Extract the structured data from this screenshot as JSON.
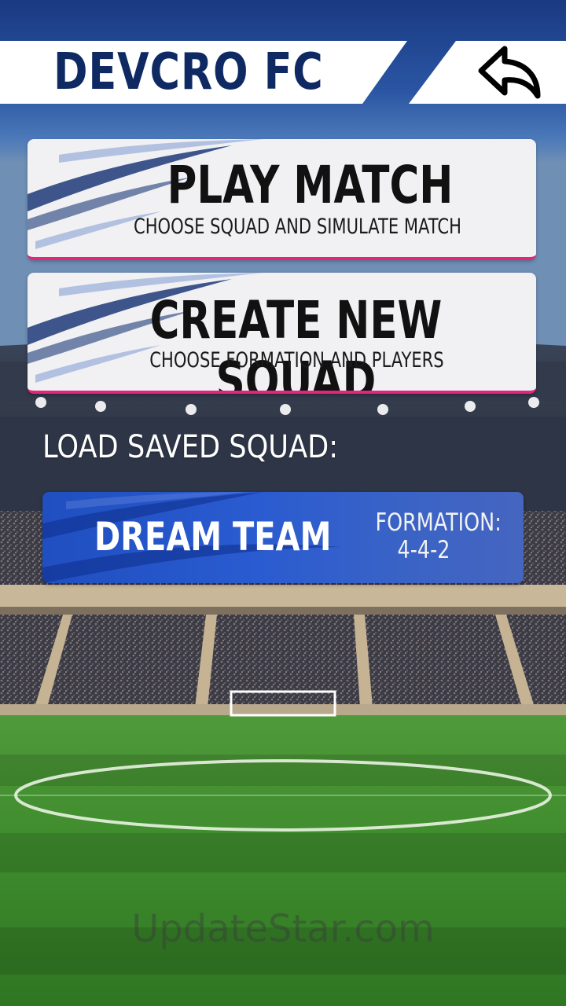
{
  "header": {
    "title": "DEVCRO FC",
    "back_icon": "back-arrow-icon"
  },
  "menu": [
    {
      "title": "PLAY MATCH",
      "subtitle": "CHOOSE SQUAD AND SIMULATE MATCH"
    },
    {
      "title": "CREATE NEW SQUAD",
      "subtitle": "CHOOSE FORMATION AND PLAYERS"
    }
  ],
  "saved": {
    "label": "LOAD SAVED SQUAD:",
    "squads": [
      {
        "name": "DREAM TEAM",
        "formation_label": "FORMATION:",
        "formation": "4-4-2"
      }
    ]
  },
  "watermark": "UpdateStar.com",
  "colors": {
    "header_text": "#0f2a63",
    "card_accent": "#e3267a",
    "squad_card": "#2a5bd0",
    "sky": "#1d3f86",
    "pitch": "#3d8a2c"
  }
}
